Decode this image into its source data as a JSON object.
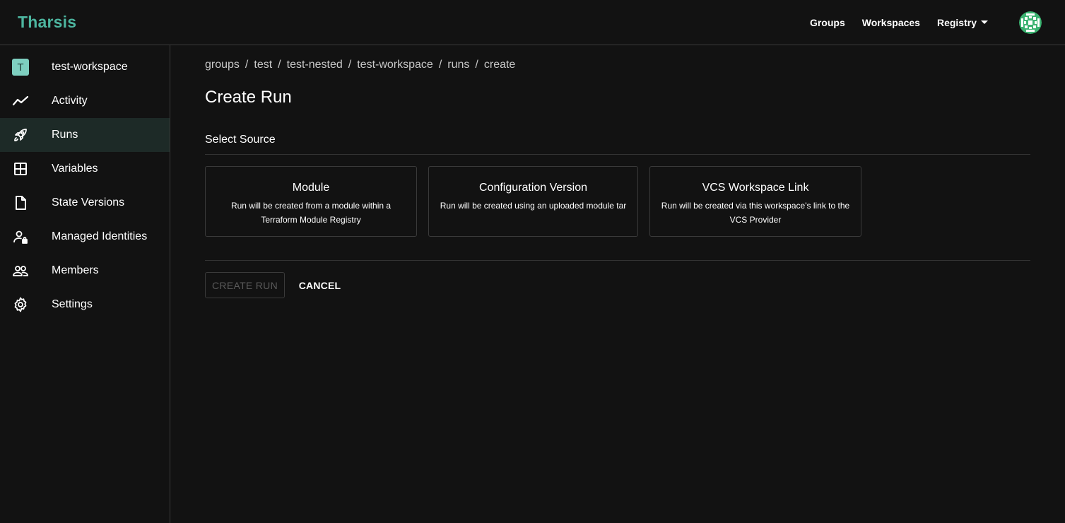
{
  "app": {
    "brand": "Tharsis"
  },
  "nav": {
    "groups": "Groups",
    "workspaces": "Workspaces",
    "registry": "Registry"
  },
  "sidebar": {
    "items": [
      {
        "label": "test-workspace",
        "icon": "workspace-badge-icon",
        "badge": "T"
      },
      {
        "label": "Activity",
        "icon": "activity-icon"
      },
      {
        "label": "Runs",
        "icon": "rocket-icon",
        "active": true
      },
      {
        "label": "Variables",
        "icon": "grid-icon"
      },
      {
        "label": "State Versions",
        "icon": "file-icon"
      },
      {
        "label": "Managed Identities",
        "icon": "user-lock-icon"
      },
      {
        "label": "Members",
        "icon": "people-icon"
      },
      {
        "label": "Settings",
        "icon": "gear-icon"
      }
    ]
  },
  "breadcrumb": [
    "groups",
    "test",
    "test-nested",
    "test-workspace",
    "runs",
    "create"
  ],
  "breadcrumb_separator": "/",
  "page": {
    "title": "Create Run",
    "section_label": "Select Source",
    "cards": [
      {
        "title": "Module",
        "description": "Run will be created from a module within a Terraform Module Registry"
      },
      {
        "title": "Configuration Version",
        "description": "Run will be created using an uploaded module tar"
      },
      {
        "title": "VCS Workspace Link",
        "description": "Run will be created via this workspace's link to the VCS Provider"
      }
    ],
    "create_button": "CREATE RUN",
    "cancel_button": "CANCEL"
  },
  "colors": {
    "brand": "#4db6a0",
    "background": "#121212",
    "active_item": "#1d2a27",
    "badge": "#7ecfc0"
  }
}
